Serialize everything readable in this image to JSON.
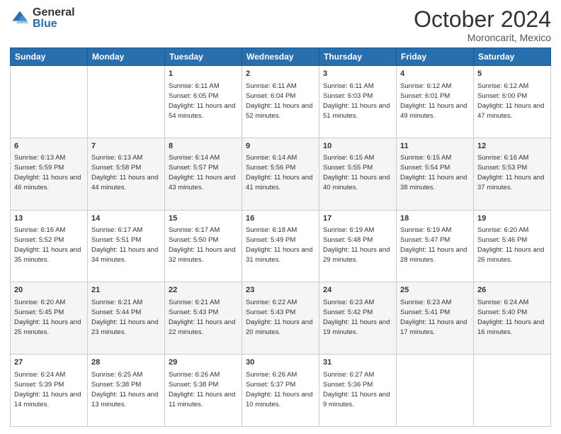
{
  "header": {
    "logo_general": "General",
    "logo_blue": "Blue",
    "month_title": "October 2024",
    "location": "Moroncarit, Mexico"
  },
  "days_of_week": [
    "Sunday",
    "Monday",
    "Tuesday",
    "Wednesday",
    "Thursday",
    "Friday",
    "Saturday"
  ],
  "weeks": [
    [
      {
        "day": "",
        "info": ""
      },
      {
        "day": "",
        "info": ""
      },
      {
        "day": "1",
        "info": "Sunrise: 6:11 AM\nSunset: 6:05 PM\nDaylight: 11 hours and 54 minutes."
      },
      {
        "day": "2",
        "info": "Sunrise: 6:11 AM\nSunset: 6:04 PM\nDaylight: 11 hours and 52 minutes."
      },
      {
        "day": "3",
        "info": "Sunrise: 6:11 AM\nSunset: 6:03 PM\nDaylight: 11 hours and 51 minutes."
      },
      {
        "day": "4",
        "info": "Sunrise: 6:12 AM\nSunset: 6:01 PM\nDaylight: 11 hours and 49 minutes."
      },
      {
        "day": "5",
        "info": "Sunrise: 6:12 AM\nSunset: 6:00 PM\nDaylight: 11 hours and 47 minutes."
      }
    ],
    [
      {
        "day": "6",
        "info": "Sunrise: 6:13 AM\nSunset: 5:59 PM\nDaylight: 11 hours and 46 minutes."
      },
      {
        "day": "7",
        "info": "Sunrise: 6:13 AM\nSunset: 5:58 PM\nDaylight: 11 hours and 44 minutes."
      },
      {
        "day": "8",
        "info": "Sunrise: 6:14 AM\nSunset: 5:57 PM\nDaylight: 11 hours and 43 minutes."
      },
      {
        "day": "9",
        "info": "Sunrise: 6:14 AM\nSunset: 5:56 PM\nDaylight: 11 hours and 41 minutes."
      },
      {
        "day": "10",
        "info": "Sunrise: 6:15 AM\nSunset: 5:55 PM\nDaylight: 11 hours and 40 minutes."
      },
      {
        "day": "11",
        "info": "Sunrise: 6:15 AM\nSunset: 5:54 PM\nDaylight: 11 hours and 38 minutes."
      },
      {
        "day": "12",
        "info": "Sunrise: 6:16 AM\nSunset: 5:53 PM\nDaylight: 11 hours and 37 minutes."
      }
    ],
    [
      {
        "day": "13",
        "info": "Sunrise: 6:16 AM\nSunset: 5:52 PM\nDaylight: 11 hours and 35 minutes."
      },
      {
        "day": "14",
        "info": "Sunrise: 6:17 AM\nSunset: 5:51 PM\nDaylight: 11 hours and 34 minutes."
      },
      {
        "day": "15",
        "info": "Sunrise: 6:17 AM\nSunset: 5:50 PM\nDaylight: 11 hours and 32 minutes."
      },
      {
        "day": "16",
        "info": "Sunrise: 6:18 AM\nSunset: 5:49 PM\nDaylight: 11 hours and 31 minutes."
      },
      {
        "day": "17",
        "info": "Sunrise: 6:19 AM\nSunset: 5:48 PM\nDaylight: 11 hours and 29 minutes."
      },
      {
        "day": "18",
        "info": "Sunrise: 6:19 AM\nSunset: 5:47 PM\nDaylight: 11 hours and 28 minutes."
      },
      {
        "day": "19",
        "info": "Sunrise: 6:20 AM\nSunset: 5:46 PM\nDaylight: 11 hours and 26 minutes."
      }
    ],
    [
      {
        "day": "20",
        "info": "Sunrise: 6:20 AM\nSunset: 5:45 PM\nDaylight: 11 hours and 25 minutes."
      },
      {
        "day": "21",
        "info": "Sunrise: 6:21 AM\nSunset: 5:44 PM\nDaylight: 11 hours and 23 minutes."
      },
      {
        "day": "22",
        "info": "Sunrise: 6:21 AM\nSunset: 5:43 PM\nDaylight: 11 hours and 22 minutes."
      },
      {
        "day": "23",
        "info": "Sunrise: 6:22 AM\nSunset: 5:43 PM\nDaylight: 11 hours and 20 minutes."
      },
      {
        "day": "24",
        "info": "Sunrise: 6:23 AM\nSunset: 5:42 PM\nDaylight: 11 hours and 19 minutes."
      },
      {
        "day": "25",
        "info": "Sunrise: 6:23 AM\nSunset: 5:41 PM\nDaylight: 11 hours and 17 minutes."
      },
      {
        "day": "26",
        "info": "Sunrise: 6:24 AM\nSunset: 5:40 PM\nDaylight: 11 hours and 16 minutes."
      }
    ],
    [
      {
        "day": "27",
        "info": "Sunrise: 6:24 AM\nSunset: 5:39 PM\nDaylight: 11 hours and 14 minutes."
      },
      {
        "day": "28",
        "info": "Sunrise: 6:25 AM\nSunset: 5:38 PM\nDaylight: 11 hours and 13 minutes."
      },
      {
        "day": "29",
        "info": "Sunrise: 6:26 AM\nSunset: 5:38 PM\nDaylight: 11 hours and 11 minutes."
      },
      {
        "day": "30",
        "info": "Sunrise: 6:26 AM\nSunset: 5:37 PM\nDaylight: 11 hours and 10 minutes."
      },
      {
        "day": "31",
        "info": "Sunrise: 6:27 AM\nSunset: 5:36 PM\nDaylight: 11 hours and 9 minutes."
      },
      {
        "day": "",
        "info": ""
      },
      {
        "day": "",
        "info": ""
      }
    ]
  ]
}
